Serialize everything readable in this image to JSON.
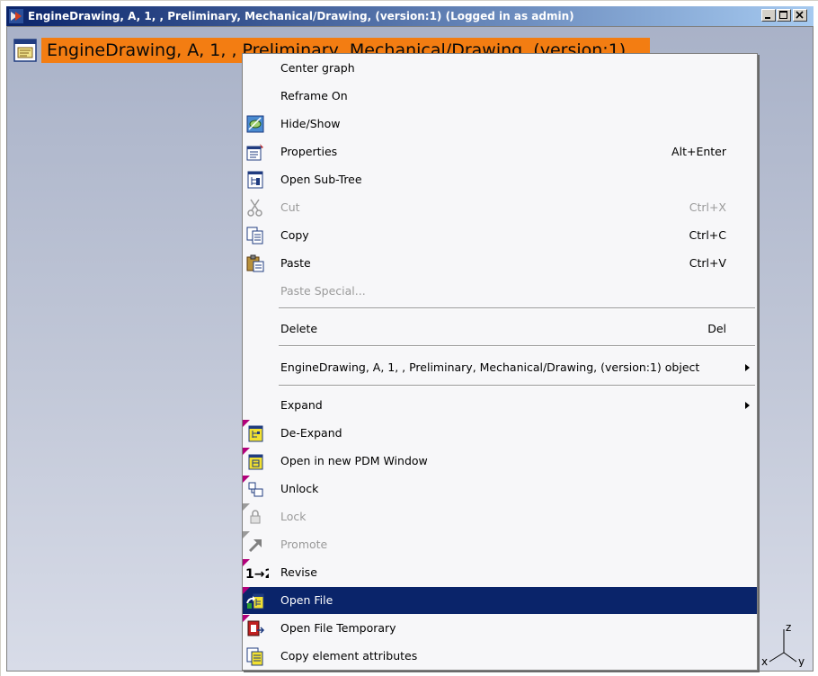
{
  "window": {
    "title": "EngineDrawing, A, 1, , Preliminary, Mechanical/Drawing,  (version:1) (Logged in as admin)",
    "buttons": [
      "minimize",
      "maximize",
      "close"
    ]
  },
  "tree": {
    "node_label": "EngineDrawing, A, 1, , Preliminary, Mechanical/Drawing,  (version:1)",
    "node_icon": "drawing-document-icon",
    "selection_color": "#f37d12"
  },
  "axis": {
    "x": "x",
    "y": "y",
    "z": "z"
  },
  "context_menu": {
    "items": [
      {
        "label": "Center graph",
        "shortcut": "",
        "icon": "",
        "enabled": true
      },
      {
        "label": "Reframe On",
        "shortcut": "",
        "icon": "",
        "enabled": true
      },
      {
        "label": "Hide/Show",
        "shortcut": "",
        "icon": "hide-show-icon",
        "enabled": true
      },
      {
        "label": "Properties",
        "shortcut": "Alt+Enter",
        "icon": "properties-icon",
        "enabled": true
      },
      {
        "label": "Open Sub-Tree",
        "shortcut": "",
        "icon": "sub-tree-icon",
        "enabled": true
      },
      {
        "label": "Cut",
        "shortcut": "Ctrl+X",
        "icon": "scissors-icon",
        "enabled": false
      },
      {
        "label": "Copy",
        "shortcut": "Ctrl+C",
        "icon": "copy-icon",
        "enabled": true
      },
      {
        "label": "Paste",
        "shortcut": "Ctrl+V",
        "icon": "paste-icon",
        "enabled": true
      },
      {
        "label": "Paste Special...",
        "shortcut": "",
        "icon": "",
        "enabled": false
      },
      {
        "label": "Delete",
        "shortcut": "Del",
        "icon": "",
        "enabled": true
      },
      {
        "label": "EngineDrawing, A, 1, , Preliminary, Mechanical/Drawing,  (version:1) object",
        "shortcut": "",
        "icon": "",
        "enabled": true,
        "submenu": true
      },
      {
        "label": "Expand",
        "shortcut": "",
        "icon": "",
        "enabled": true,
        "submenu": true
      },
      {
        "label": "De-Expand",
        "shortcut": "",
        "icon": "de-expand-icon",
        "enabled": true
      },
      {
        "label": "Open in new PDM Window",
        "shortcut": "",
        "icon": "pdm-window-icon",
        "enabled": true
      },
      {
        "label": "Unlock",
        "shortcut": "",
        "icon": "unlock-icon",
        "enabled": true
      },
      {
        "label": "Lock",
        "shortcut": "",
        "icon": "lock-icon",
        "enabled": false
      },
      {
        "label": "Promote",
        "shortcut": "",
        "icon": "promote-icon",
        "enabled": false
      },
      {
        "label": "Revise",
        "shortcut": "",
        "icon": "revise-icon",
        "icon_text": "1→2",
        "enabled": true
      },
      {
        "label": "Open File",
        "shortcut": "",
        "icon": "open-file-icon",
        "enabled": true,
        "selected": true
      },
      {
        "label": "Open File Temporary",
        "shortcut": "",
        "icon": "open-file-temporary-icon",
        "enabled": true
      },
      {
        "label": "Copy element attributes",
        "shortcut": "",
        "icon": "copy-attributes-icon",
        "enabled": true
      }
    ]
  }
}
